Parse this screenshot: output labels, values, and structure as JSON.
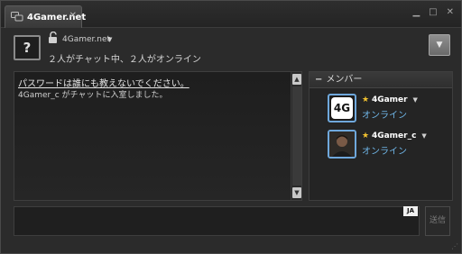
{
  "window": {
    "tab_label": "4Gamer.net",
    "tab_close": "✕",
    "minimize": "▁",
    "maximize": "□",
    "close": "✕"
  },
  "header": {
    "help_label": "?",
    "room_name": "4Gamer.net",
    "status": "２人がチャット中、２人がオンライン"
  },
  "chat": {
    "messages": [
      "パスワードは誰にも教えないでください。",
      "4Gamer_c がチャットに入室しました。"
    ]
  },
  "members": {
    "header": "メンバー",
    "list": [
      {
        "name": "4Gamer",
        "status": "オンライン",
        "avatar_text": "4G"
      },
      {
        "name": "4Gamer_c",
        "status": "オンライン"
      }
    ]
  },
  "input": {
    "lang_badge": "JA",
    "send_label": "送信"
  },
  "colors": {
    "accent": "#6fb6e8",
    "star": "#f2c230",
    "background": "#2b2b2b"
  }
}
